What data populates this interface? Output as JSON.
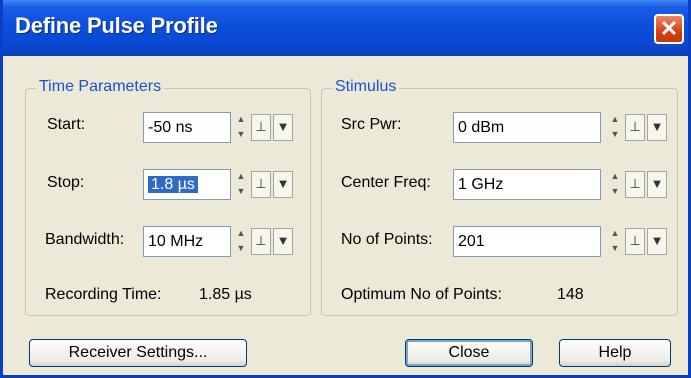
{
  "window": {
    "title": "Define Pulse Profile",
    "close_glyph": "✕"
  },
  "time_params": {
    "title": "Time Parameters",
    "start": {
      "label": "Start:",
      "value": "-50 ns"
    },
    "stop": {
      "label": "Stop:",
      "value": "1.8 µs"
    },
    "bandwidth": {
      "label": "Bandwidth:",
      "value": "10 MHz"
    },
    "recording": {
      "label": "Recording Time:",
      "value": "1.85 µs"
    }
  },
  "stimulus": {
    "title": "Stimulus",
    "src_pwr": {
      "label": "Src Pwr:",
      "value": "0 dBm"
    },
    "center_freq": {
      "label": "Center Freq:",
      "value": "1 GHz"
    },
    "points": {
      "label": "No of Points:",
      "value": "201"
    },
    "optimum": {
      "label": "Optimum No of Points:",
      "value": "148"
    }
  },
  "icons": {
    "spin_up": "▲",
    "spin_down": "▼",
    "step": "⊥",
    "dropdown": "▼"
  },
  "buttons": {
    "receiver": "Receiver Settings...",
    "close": "Close",
    "help": "Help"
  }
}
